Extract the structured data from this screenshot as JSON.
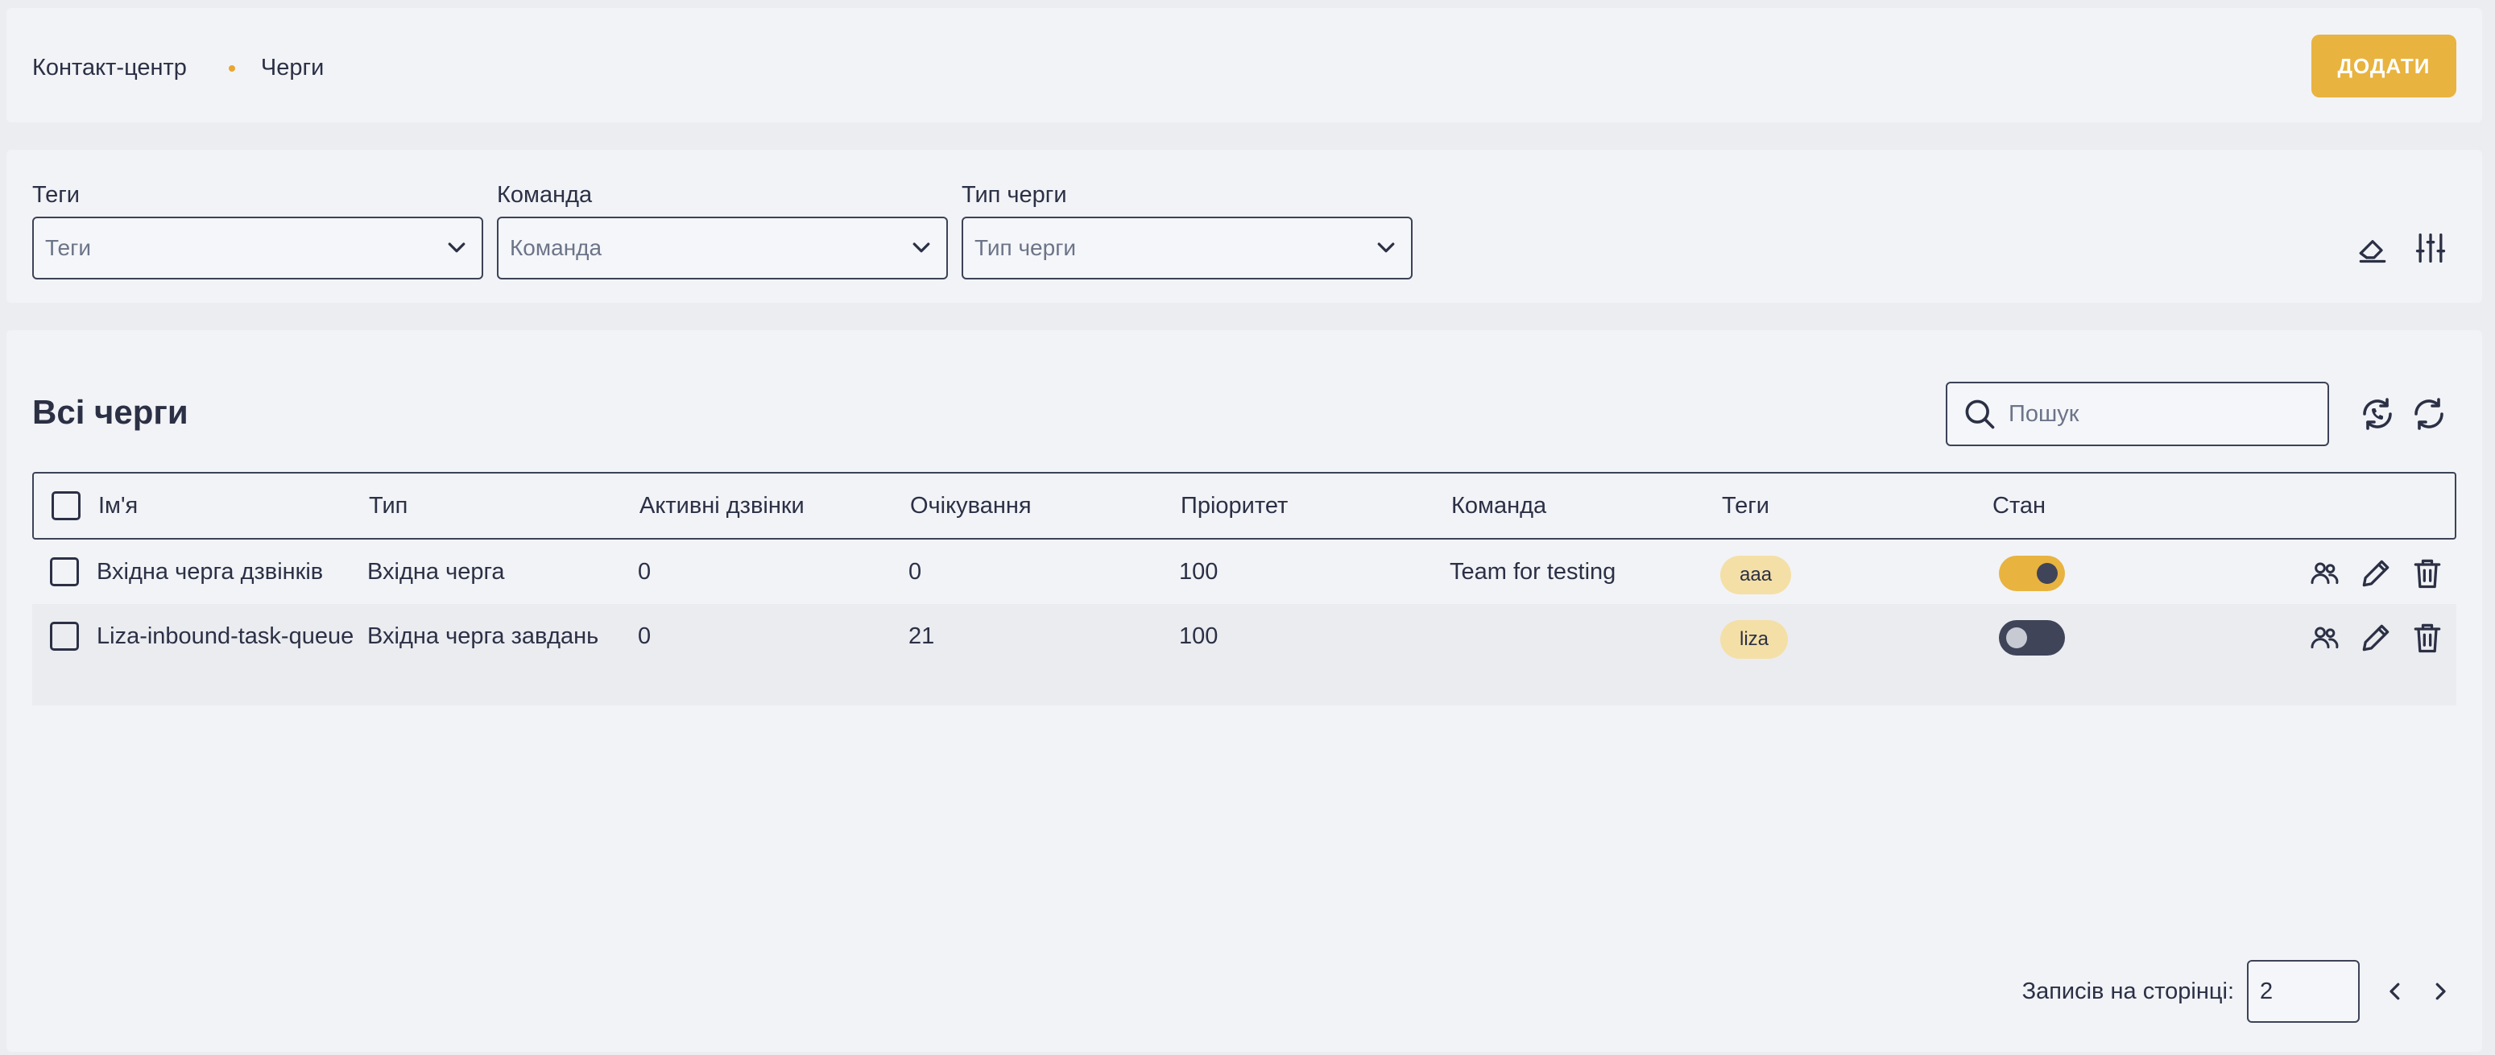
{
  "header": {
    "breadcrumb": [
      "Контакт-центр",
      "Черги"
    ],
    "add_label": "ДОДАТИ"
  },
  "filters": [
    {
      "label": "Теги",
      "placeholder": "Теги"
    },
    {
      "label": "Команда",
      "placeholder": "Команда"
    },
    {
      "label": "Тип черги",
      "placeholder": "Тип черги"
    }
  ],
  "main": {
    "title": "Всі черги",
    "search_placeholder": "Пошук"
  },
  "table": {
    "columns": [
      "Ім'я",
      "Тип",
      "Активні дзвінки",
      "Очікування",
      "Пріоритет",
      "Команда",
      "Теги",
      "Стан"
    ],
    "rows": [
      {
        "name": "Вхідна черга дзвінків",
        "type": "Вхідна черга",
        "active_calls": "0",
        "waiting": "0",
        "priority": "100",
        "team": "Team for testing",
        "tag": "aaa",
        "enabled": true
      },
      {
        "name": "Liza-inbound-task-queue",
        "type": "Вхідна черга завдань",
        "active_calls": "0",
        "waiting": "21",
        "priority": "100",
        "team": "",
        "tag": "liza",
        "enabled": false
      }
    ]
  },
  "pagination": {
    "label": "Записів на сторінці:",
    "page_size": "2"
  },
  "colors": {
    "accent": "#e8b33f",
    "dark": "#3f4459",
    "tag_bg": "#f4dfa6"
  },
  "icons": [
    "eraser-icon",
    "filter-sliders-icon",
    "search-icon",
    "phone-refresh-icon",
    "refresh-icon",
    "members-icon",
    "edit-icon",
    "delete-icon",
    "chevron-down-icon",
    "chevron-left-icon",
    "chevron-right-icon"
  ]
}
